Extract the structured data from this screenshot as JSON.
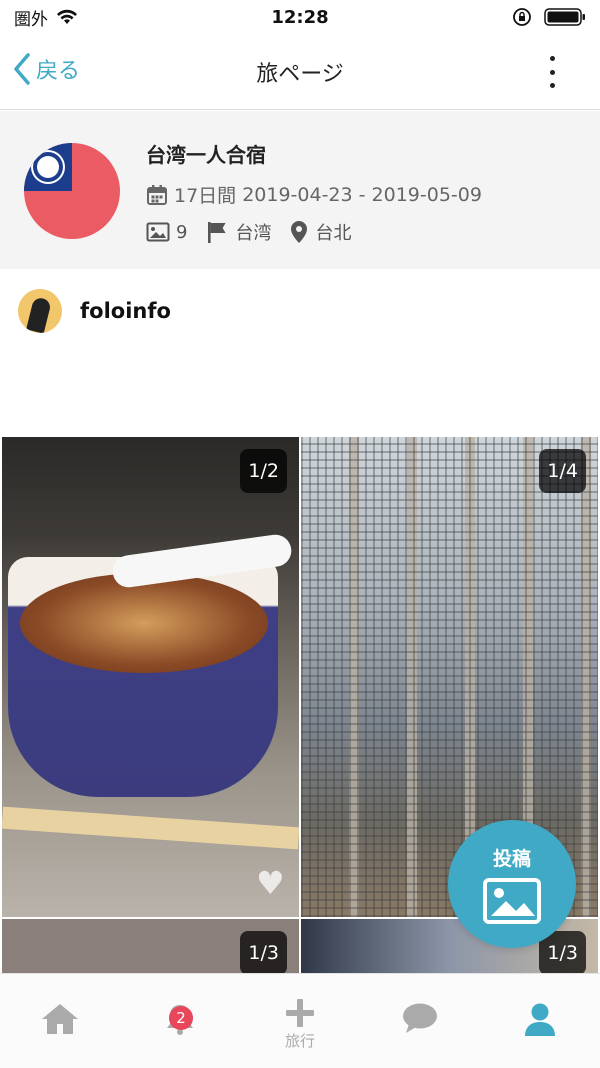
{
  "status_bar": {
    "carrier": "圏外",
    "time": "12:28"
  },
  "nav": {
    "back_label": "戻る",
    "title": "旅ページ"
  },
  "trip": {
    "title": "台湾一人合宿",
    "duration": "17日間",
    "date_range": "2019-04-23 - 2019-05-09",
    "photo_count": "9",
    "country": "台湾",
    "city": "台北",
    "flag_icon": "taiwan-flag"
  },
  "user": {
    "username": "foloinfo"
  },
  "photos": [
    {
      "counter": "1/2",
      "subject": "noodle-soup-cup"
    },
    {
      "counter": "1/4",
      "subject": "window-screen-view"
    },
    {
      "counter": "1/3",
      "subject": "wood-texture"
    },
    {
      "counter": "1/3",
      "subject": "street-light"
    }
  ],
  "fab": {
    "label": "投稿",
    "icon": "image-icon",
    "color": "#3fa9c6"
  },
  "tab_bar": {
    "items": [
      {
        "icon": "home-icon",
        "label": ""
      },
      {
        "icon": "bell-icon",
        "label": "",
        "badge": "2"
      },
      {
        "icon": "plus-icon",
        "label": "旅行"
      },
      {
        "icon": "chat-icon",
        "label": ""
      },
      {
        "icon": "user-icon",
        "label": "",
        "active": true
      }
    ]
  },
  "colors": {
    "accent": "#3fa9c6",
    "badge": "#e7465b"
  }
}
